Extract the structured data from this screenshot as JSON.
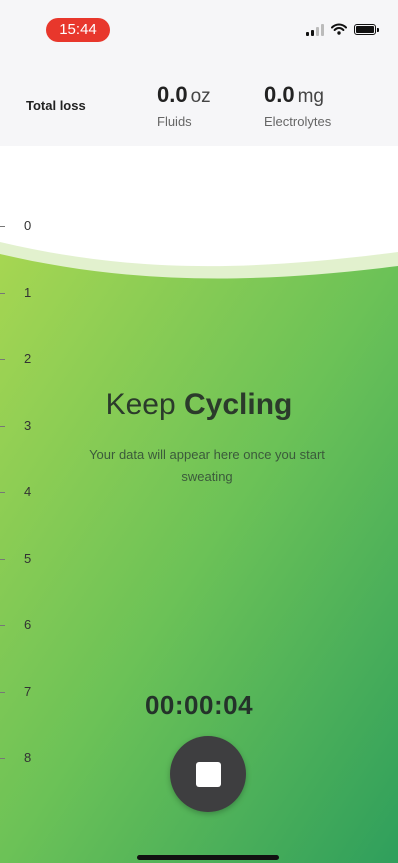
{
  "status_bar": {
    "time": "15:44"
  },
  "header": {
    "total_loss_label": "Total loss",
    "fluids": {
      "value": "0.0",
      "unit": "oz",
      "label": "Fluids"
    },
    "electrolytes": {
      "value": "0.0",
      "unit": "mg",
      "label": "Electrolytes"
    }
  },
  "scale": [
    "0",
    "1",
    "2",
    "3",
    "4",
    "5",
    "6",
    "7",
    "8"
  ],
  "main": {
    "title_prefix": "Keep ",
    "title_activity": "Cycling",
    "subtitle": "Your data will appear here once you start sweating",
    "timer": "00:00:04"
  },
  "colors": {
    "accent_light": "#a6d652",
    "accent_dark": "#2f9f5c",
    "recording_pill": "#e8372c",
    "stop_button": "#3e3e40"
  },
  "icons": {
    "signal": "signal-bars-icon",
    "wifi": "wifi-icon",
    "battery": "battery-icon",
    "stop": "stop-square-icon"
  }
}
